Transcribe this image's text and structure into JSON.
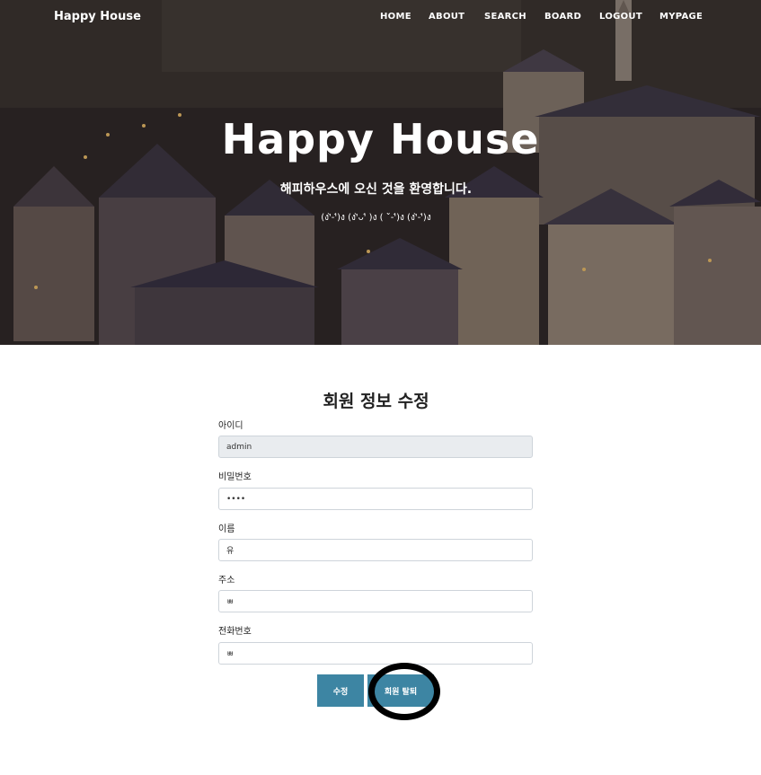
{
  "navbar": {
    "brand": "Happy House",
    "items": [
      "HOME",
      "ABOUT",
      "SEARCH",
      "BOARD",
      "LOGOUT",
      "MYPAGE"
    ]
  },
  "hero": {
    "title": "Happy House",
    "subtitle": "해피하우스에 오신 것을 환영합니다.",
    "kaomoji": "(ง'̀-'́)ง (ง'̀ᴗ'́ )ง ( ˘̀-'́)ง (ง'̀-'́)ง"
  },
  "form": {
    "title": "회원 정보 수정",
    "fields": [
      {
        "label": "아이디",
        "value": "admin",
        "readonly": true
      },
      {
        "label": "비밀번호",
        "value": "••••",
        "readonly": false
      },
      {
        "label": "이름",
        "value": "유",
        "readonly": false
      },
      {
        "label": "주소",
        "value": "ㅃ",
        "readonly": false
      },
      {
        "label": "전화번호",
        "value": "ㅃ",
        "readonly": false
      }
    ],
    "buttons": {
      "update": "수정",
      "withdraw": "회원 탈퇴"
    }
  },
  "colors": {
    "button": "#3d85a3",
    "readonly_bg": "#e9ecef",
    "annotation": "#000000"
  }
}
